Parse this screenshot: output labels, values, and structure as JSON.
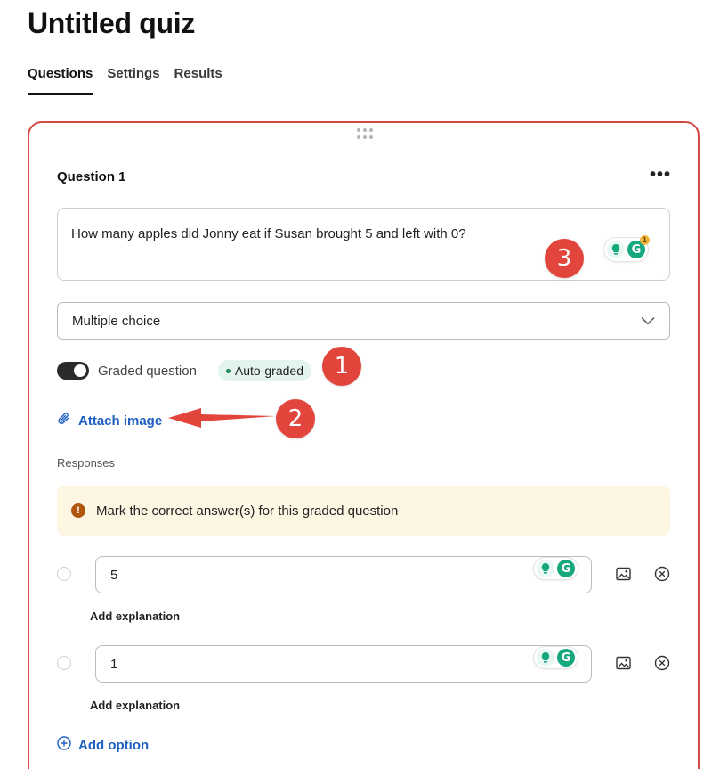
{
  "page": {
    "title": "Untitled quiz"
  },
  "tabs": [
    {
      "label": "Questions",
      "active": true
    },
    {
      "label": "Settings",
      "active": false
    },
    {
      "label": "Results",
      "active": false
    }
  ],
  "question": {
    "title": "Question 1",
    "more_icon": "more-horizontal-icon",
    "more_glyph": "•••",
    "text": "How many apples did Jonny eat if Susan brought 5 and left with 0?",
    "grammarly_badge_count": "1"
  },
  "question_type": {
    "selected": "Multiple choice"
  },
  "graded": {
    "label": "Graded question",
    "on": true,
    "badge": "Auto-graded"
  },
  "attach": {
    "label": "Attach image"
  },
  "responses": {
    "label": "Responses",
    "notice": "Mark the correct answer(s) for this graded question",
    "notice_glyph": "!",
    "options": [
      {
        "value": "5",
        "add_explanation": "Add explanation"
      },
      {
        "value": "1",
        "add_explanation": "Add explanation"
      }
    ],
    "add_option_label": "Add option"
  },
  "annotations": {
    "markers": [
      "1",
      "2",
      "3"
    ]
  },
  "colors": {
    "accent_border": "#d24a43",
    "link_blue": "#1f5fbf",
    "marker_red": "#e2453c",
    "badge_green_bg": "#e3f4ec",
    "notice_bg": "#fdf6e3",
    "grammarly_green": "#15a87f"
  }
}
